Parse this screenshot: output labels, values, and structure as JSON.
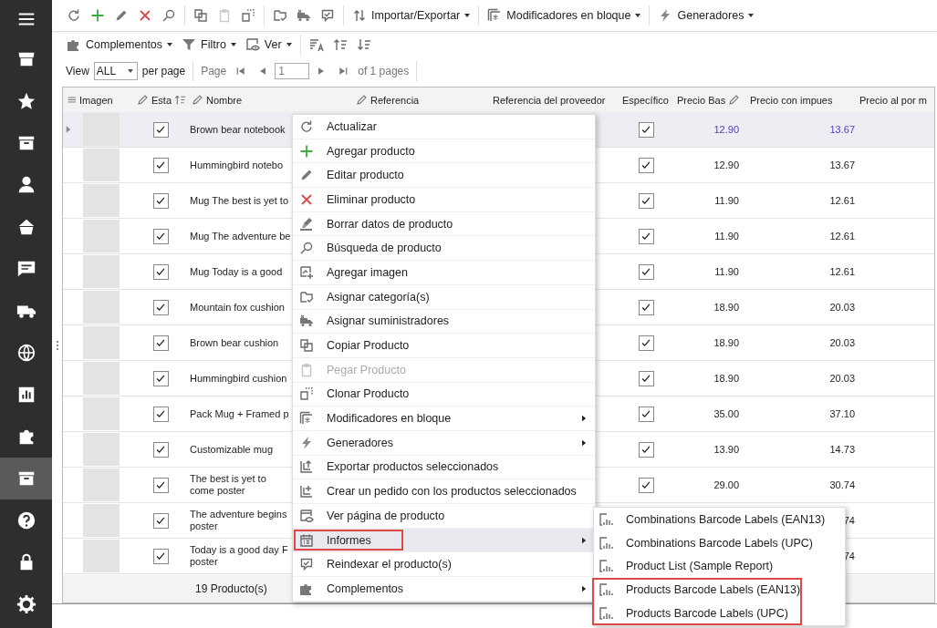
{
  "sidebar": {
    "items": [
      {
        "selected": false
      },
      {
        "selected": false
      },
      {
        "selected": false
      },
      {
        "selected": false
      },
      {
        "selected": false
      },
      {
        "selected": false
      },
      {
        "selected": false
      },
      {
        "selected": false
      },
      {
        "selected": false
      },
      {
        "selected": false
      },
      {
        "selected": true
      },
      {
        "selected": false
      },
      {
        "selected": false
      },
      {
        "selected": false
      }
    ]
  },
  "toolbar": {
    "icon_buttons": [
      {
        "disabled": false
      },
      {
        "disabled": false
      },
      {
        "disabled": false
      },
      {
        "disabled": false
      },
      {
        "disabled": false
      },
      {
        "disabled": false
      },
      {
        "disabled": true
      },
      {
        "disabled": false
      },
      {
        "disabled": false
      },
      {
        "disabled": false
      },
      {
        "disabled": false
      }
    ],
    "menus": [
      {
        "label": "Importar/Exportar"
      },
      {
        "label": "Modificadores en bloque"
      },
      {
        "label": "Generadores"
      }
    ]
  },
  "toolbar2": {
    "menus": [
      {
        "label": "Complementos"
      },
      {
        "label": "Filtro"
      },
      {
        "label": "Ver"
      }
    ],
    "icon_buttons": [
      {
        "disabled": false
      },
      {
        "disabled": false
      },
      {
        "disabled": false
      }
    ]
  },
  "pager": {
    "view_label": "View",
    "per_page_value": "ALL",
    "per_page_label": "per page",
    "page_label": "Page",
    "page_value": "1",
    "pages_text": "of 1 pages"
  },
  "grid": {
    "columns": [
      "Imagen",
      "Esta",
      "Nombre",
      "Referencia",
      "Referencia del proveedor",
      "Específico",
      "Precio Bas",
      "Precio con impues",
      "Precio al por m"
    ],
    "rows": [
      {
        "name": "Brown bear notebook",
        "status": true,
        "specific": true,
        "price_base": "12.90",
        "price_tax": "13.67",
        "selected": true
      },
      {
        "name": "Hummingbird notebo",
        "status": true,
        "specific": true,
        "price_base": "12.90",
        "price_tax": "13.67",
        "selected": false
      },
      {
        "name": "Mug The best is yet to",
        "status": true,
        "specific": true,
        "price_base": "11.90",
        "price_tax": "12.61",
        "selected": false
      },
      {
        "name": "Mug The adventure be",
        "status": true,
        "specific": true,
        "price_base": "11.90",
        "price_tax": "12.61",
        "selected": false
      },
      {
        "name": "Mug Today is a good",
        "status": true,
        "specific": true,
        "price_base": "11.90",
        "price_tax": "12.61",
        "selected": false
      },
      {
        "name": "Mountain fox cushion",
        "status": true,
        "specific": true,
        "price_base": "18.90",
        "price_tax": "20.03",
        "selected": false
      },
      {
        "name": "Brown bear cushion",
        "status": true,
        "specific": true,
        "price_base": "18.90",
        "price_tax": "20.03",
        "selected": false
      },
      {
        "name": "Hummingbird cushion",
        "status": true,
        "specific": true,
        "price_base": "18.90",
        "price_tax": "20.03",
        "selected": false
      },
      {
        "name": "Pack Mug + Framed p",
        "status": true,
        "specific": true,
        "price_base": "35.00",
        "price_tax": "37.10",
        "selected": false
      },
      {
        "name": "Customizable mug",
        "status": true,
        "specific": true,
        "price_base": "13.90",
        "price_tax": "14.73",
        "selected": false
      },
      {
        "name": "The best is yet to come poster",
        "status": true,
        "specific": true,
        "price_base": "29.00",
        "price_tax": "30.74",
        "selected": false
      },
      {
        "name": "The adventure begins poster",
        "status": true,
        "price_tax": "74",
        "selected": false
      },
      {
        "name": "Today is a good day F poster",
        "status": true,
        "price_tax": "74",
        "selected": false
      }
    ],
    "footer": "19 Producto(s)"
  },
  "context_menu": {
    "items": [
      {
        "label": "Actualizar",
        "disabled": false,
        "has_submenu": false,
        "selected": false,
        "annotated": false
      },
      {
        "label": "Agregar producto",
        "disabled": false,
        "has_submenu": false,
        "selected": false,
        "annotated": false
      },
      {
        "label": "Editar producto",
        "disabled": false,
        "has_submenu": false,
        "selected": false,
        "annotated": false
      },
      {
        "label": "Eliminar producto",
        "disabled": false,
        "has_submenu": false,
        "selected": false,
        "annotated": false
      },
      {
        "label": "Borrar datos de producto",
        "disabled": false,
        "has_submenu": false,
        "selected": false,
        "annotated": false
      },
      {
        "label": "Búsqueda de producto",
        "disabled": false,
        "has_submenu": false,
        "selected": false,
        "annotated": false
      },
      {
        "label": "Agregar imagen",
        "disabled": false,
        "has_submenu": false,
        "selected": false,
        "annotated": false
      },
      {
        "label": "Asignar categoría(s)",
        "disabled": false,
        "has_submenu": false,
        "selected": false,
        "annotated": false
      },
      {
        "label": "Asignar suministradores",
        "disabled": false,
        "has_submenu": false,
        "selected": false,
        "annotated": false
      },
      {
        "label": "Copiar Producto",
        "disabled": false,
        "has_submenu": false,
        "selected": false,
        "annotated": false
      },
      {
        "label": "Pegar Producto",
        "disabled": true,
        "has_submenu": false,
        "selected": false,
        "annotated": false
      },
      {
        "label": "Clonar Producto",
        "disabled": false,
        "has_submenu": false,
        "selected": false,
        "annotated": false
      },
      {
        "label": "Modificadores en bloque",
        "disabled": false,
        "has_submenu": true,
        "selected": false,
        "annotated": false
      },
      {
        "label": "Generadores",
        "disabled": false,
        "has_submenu": true,
        "selected": false,
        "annotated": false
      },
      {
        "label": "Exportar productos seleccionados",
        "disabled": false,
        "has_submenu": false,
        "selected": false,
        "annotated": false
      },
      {
        "label": "Crear un pedido con los productos seleccionados",
        "disabled": false,
        "has_submenu": false,
        "selected": false,
        "annotated": false
      },
      {
        "label": "Ver página de producto",
        "disabled": false,
        "has_submenu": false,
        "selected": false,
        "annotated": false
      },
      {
        "label": "Informes",
        "disabled": false,
        "has_submenu": true,
        "selected": true,
        "annotated": true
      },
      {
        "label": "Reindexar el producto(s)",
        "disabled": false,
        "has_submenu": false,
        "selected": false,
        "annotated": false
      },
      {
        "label": "Complementos",
        "disabled": false,
        "has_submenu": true,
        "selected": false,
        "annotated": false
      }
    ]
  },
  "submenu": {
    "items": [
      {
        "label": "Combinations Barcode Labels (EAN13)",
        "annotated": false
      },
      {
        "label": "Combinations Barcode Labels (UPC)",
        "annotated": false
      },
      {
        "label": "Product List (Sample Report)",
        "annotated": false
      },
      {
        "label": "Products Barcode Labels (EAN13)",
        "annotated": true
      },
      {
        "label": "Products Barcode Labels (UPC)",
        "annotated": true
      }
    ]
  }
}
